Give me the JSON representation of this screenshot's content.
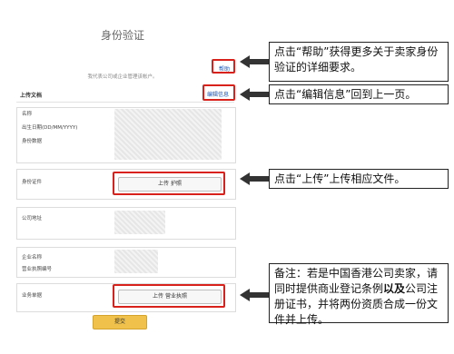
{
  "page": {
    "title": "身份验证",
    "subtitle": "我代表公司或企业管理该帐户。",
    "help_link": "帮助",
    "section_label": "上传文档",
    "edit_link": "编辑信息"
  },
  "form": {
    "fields": [
      {
        "label": "名称"
      },
      {
        "label": "出生日期(DD/MM/YYYY)"
      },
      {
        "label": "身份数据"
      },
      {
        "label": "身份证件"
      },
      {
        "label": "公司地址"
      },
      {
        "label": "企业名称"
      },
      {
        "label": "营业执照编号"
      },
      {
        "label": "业务单据"
      }
    ],
    "upload_passport": "上传 护照",
    "upload_license": "上传 营业执照",
    "submit": "提交"
  },
  "callouts": {
    "help": "点击“帮助”获得更多关于卖家身份验证的详细要求。",
    "edit": "点击“编辑信息”回到上一页。",
    "upload": "点击“上传”上传相应文件。",
    "note_prefix": "备注：若是中国香港公司卖家，请同时提供商业登记条例",
    "note_bold": "以及",
    "note_suffix": "公司注册证书，并将两份资质合成一份文件并上传。"
  },
  "colors": {
    "highlight": "#d8211a",
    "link": "#1a56b8",
    "submit": "#f0c24b"
  }
}
